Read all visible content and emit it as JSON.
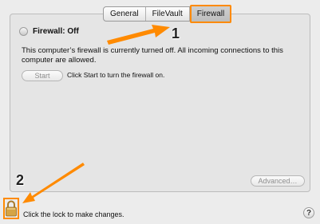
{
  "tabs": [
    {
      "label": "General",
      "active": false
    },
    {
      "label": "FileVault",
      "active": false
    },
    {
      "label": "Firewall",
      "active": true
    }
  ],
  "firewall": {
    "status_label": "Firewall: Off",
    "description": "This computer’s firewall is currently turned off. All incoming connections to this computer are allowed.",
    "start_button": "Start",
    "start_hint": "Click Start to turn the firewall on.",
    "advanced_button": "Advanced…"
  },
  "footer": {
    "lock_icon": "padlock-icon",
    "lock_label": "Click the lock to make changes.",
    "help_label": "?"
  },
  "annotations": [
    {
      "number": "1",
      "target": "Firewall tab"
    },
    {
      "number": "2",
      "target": "lock"
    }
  ],
  "colors": {
    "annotation": "#ff8a00",
    "background": "#ececec",
    "panel": "#e5e5e5"
  }
}
